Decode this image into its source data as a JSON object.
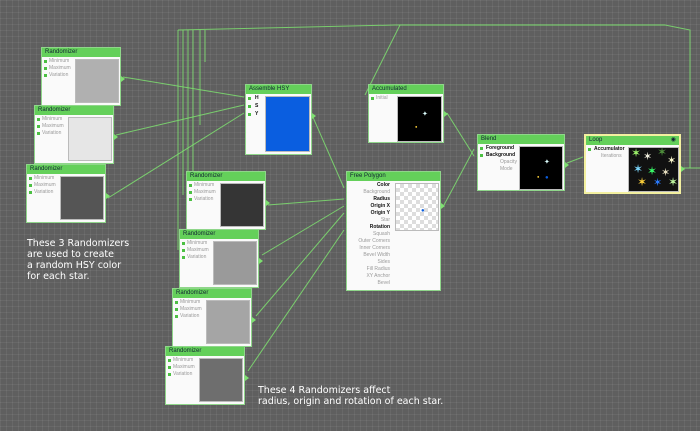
{
  "randomizer_ports": [
    "Minimum",
    "Maximum",
    "Variation"
  ],
  "randomizers": [
    {
      "title": "Randomizer",
      "preview_color": "#b0b0b0"
    },
    {
      "title": "Randomizer",
      "preview_color": "#e6e6e6"
    },
    {
      "title": "Randomizer",
      "preview_color": "#555555"
    },
    {
      "title": "Randomizer",
      "preview_color": "#353535"
    },
    {
      "title": "Randomizer",
      "preview_color": "#9a9a9a"
    },
    {
      "title": "Randomizer",
      "preview_color": "#a5a5a5"
    },
    {
      "title": "Randomizer",
      "preview_color": "#6e6e6e"
    }
  ],
  "assemble_hsy": {
    "title": "Assemble HSY",
    "ports": [
      "H",
      "S",
      "Y"
    ],
    "preview_color": "#0a5ee0"
  },
  "accumulated": {
    "title": "Accumulated",
    "ports": [
      "Initial"
    ]
  },
  "free_polygon": {
    "title": "Free Polygon",
    "ports": [
      "Color",
      "Background",
      "Radius",
      "Origin X",
      "Origin Y",
      "Star",
      "Rotation",
      "Squash",
      "Outer Corners",
      "Inner Corners",
      "Bevel Width",
      "Sides",
      "Fill Radius",
      "XY Anchor",
      "Bevel"
    ]
  },
  "blend": {
    "title": "Blend",
    "ports": [
      "Foreground",
      "Background",
      "Opacity",
      "Mode"
    ]
  },
  "loop": {
    "title": "Loop",
    "ports": [
      "Accumulator",
      "Iterations"
    ]
  },
  "annotations": {
    "hsy": "These 3 Randomizers\nare used to create\na random HSY color\nfor each star.",
    "polygon": "These 4 Randomizers affect\nradius, origin and rotation of each star."
  },
  "colors": {
    "wire": "#7ee070",
    "title_bar": "#64d05a",
    "selected_border": "#f3f0a0"
  }
}
